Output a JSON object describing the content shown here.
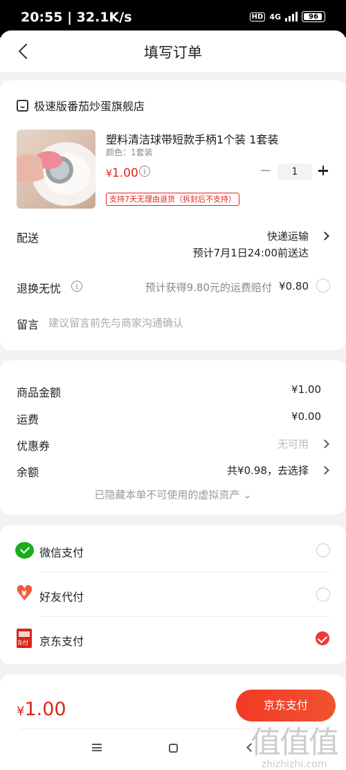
{
  "status_bar": {
    "time": "20:55 | 32.1K/s",
    "hd": "HD",
    "network": "4G",
    "battery": "96"
  },
  "header": {
    "title": "填写订单"
  },
  "shop": {
    "name": "极速版番茄炒蛋旗舰店"
  },
  "product": {
    "name": "塑料清洁球带短款手柄1个装 1套装",
    "spec": "颜色：1套装",
    "price_symbol": "¥",
    "price": "1.00",
    "quantity": "1",
    "return_tag": "支持7天无理由退货（拆封后不支持）"
  },
  "delivery": {
    "label": "配送",
    "method": "快递运输",
    "eta": "预计7月1日24:00前送达"
  },
  "return_insurance": {
    "label": "退换无忧",
    "desc": "预计获得9.80元的运费赔付",
    "price": "¥0.80"
  },
  "message": {
    "label": "留言",
    "placeholder": "建议留言前先与商家沟通确认"
  },
  "summary": {
    "goods_label": "商品金额",
    "goods_value": "¥1.00",
    "shipping_label": "运费",
    "shipping_value": "¥0.00",
    "coupon_label": "优惠券",
    "coupon_value": "无可用",
    "balance_label": "余额",
    "balance_value": "共¥0.98，去选择",
    "hidden_assets": "已隐藏本单不可使用的虚拟资产 ⌄"
  },
  "payment_methods": [
    {
      "label": "微信支付",
      "selected": false
    },
    {
      "label": "好友代付",
      "selected": false
    },
    {
      "label": "京东支付",
      "selected": true
    }
  ],
  "jdpay_icon_text": "东付",
  "bottom": {
    "total_symbol": "¥",
    "total": "1.00",
    "pay_button": "京东支付"
  },
  "watermark": {
    "big": "值值值",
    "small": "zhizhizhi.com"
  },
  "colors": {
    "accent": "#e2231a",
    "wechat": "#1aad19"
  }
}
